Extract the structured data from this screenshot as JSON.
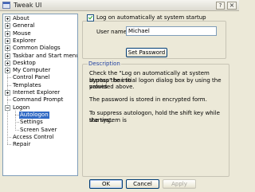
{
  "window": {
    "title": "Tweak UI",
    "help_glyph": "?",
    "close_glyph": "×"
  },
  "tree": {
    "items": [
      {
        "label": "About",
        "expander": "plus"
      },
      {
        "label": "General",
        "expander": "plus"
      },
      {
        "label": "Mouse",
        "expander": "plus"
      },
      {
        "label": "Explorer",
        "expander": "plus"
      },
      {
        "label": "Common Dialogs",
        "expander": "plus"
      },
      {
        "label": "Taskbar and Start menu",
        "expander": "plus"
      },
      {
        "label": "Desktop",
        "expander": "plus"
      },
      {
        "label": "My Computer",
        "expander": "plus"
      },
      {
        "label": "Control Panel",
        "expander": "none"
      },
      {
        "label": "Templates",
        "expander": "none"
      },
      {
        "label": "Internet Explorer",
        "expander": "plus"
      },
      {
        "label": "Command Prompt",
        "expander": "none"
      },
      {
        "label": "Logon",
        "expander": "minus"
      },
      {
        "label": "Autologon",
        "expander": "child",
        "selected": true
      },
      {
        "label": "Settings",
        "expander": "child"
      },
      {
        "label": "Screen Saver",
        "expander": "child"
      },
      {
        "label": "Access Control",
        "expander": "none"
      },
      {
        "label": "Repair",
        "expander": "none"
      }
    ]
  },
  "autologon": {
    "checkbox_label": "Log on automatically at system startup",
    "checked": true,
    "username_label": "User name:",
    "username_value": "Michael",
    "set_password_label": "Set Password"
  },
  "description": {
    "legend": "Description",
    "paragraphs": [
      [
        "Check the \"Log on automatically at system startup\" box to",
        "bypass the initial logon dialog box by using the values",
        "provided above."
      ],
      [
        "The password is stored in encrypted form."
      ],
      [
        "To suppress autologon, hold the shift key while the system is",
        "starting."
      ]
    ]
  },
  "buttons": {
    "ok": "OK",
    "cancel": "Cancel",
    "apply": "Apply"
  }
}
